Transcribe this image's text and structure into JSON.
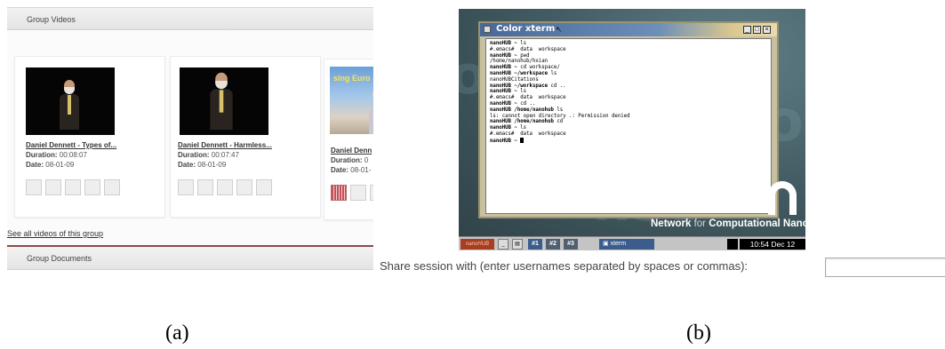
{
  "panel_a": {
    "header_videos": "Group Videos",
    "header_documents": "Group Documents",
    "duration_label": "Duration:",
    "date_label": "Date:",
    "videos": [
      {
        "title": "Daniel Dennett - Types of...",
        "duration": "00:08:07",
        "date": "08-01-09"
      },
      {
        "title": "Daniel Dennett - Harmless...",
        "duration": "00:07:47",
        "date": "08-01-09"
      },
      {
        "title": "Daniel Denn",
        "duration": "0",
        "date": "08-01-",
        "thumbnail_banner": "sing Euro"
      }
    ],
    "see_all_link": "See all videos of this group"
  },
  "panel_b": {
    "xterm_title": "Color xterm",
    "terminal_lines": [
      [
        {
          "t": "nanoHUB ~",
          "b": true
        },
        {
          "t": " ls"
        }
      ],
      [
        {
          "t": "#.emacs#  data  workspace"
        }
      ],
      [
        {
          "t": "nanoHUB ~",
          "b": true
        },
        {
          "t": " pwd"
        }
      ],
      [
        {
          "t": "/home/nanohub/hxian"
        }
      ],
      [
        {
          "t": "nanoHUB ~",
          "b": true
        },
        {
          "t": " cd workspace/"
        }
      ],
      [
        {
          "t": "nanoHUB ~/workspace",
          "b": true
        },
        {
          "t": " ls"
        }
      ],
      [
        {
          "t": "nanoHUBCitations"
        }
      ],
      [
        {
          "t": "nanoHUB ~/workspace",
          "b": true
        },
        {
          "t": " cd .."
        }
      ],
      [
        {
          "t": "nanoHUB ~",
          "b": true
        },
        {
          "t": " ls"
        }
      ],
      [
        {
          "t": "#.emacs#  data  workspace"
        }
      ],
      [
        {
          "t": "nanoHUB ~",
          "b": true
        },
        {
          "t": " cd .."
        }
      ],
      [
        {
          "t": "nanoHUB /home/nanohub",
          "b": true
        },
        {
          "t": " ls"
        }
      ],
      [
        {
          "t": "ls: cannot open directory .: Permission denied"
        }
      ],
      [
        {
          "t": "nanoHUB /home/nanohub",
          "b": true
        },
        {
          "t": " cd"
        }
      ],
      [
        {
          "t": "nanoHUB ~",
          "b": true
        },
        {
          "t": " ls"
        }
      ],
      [
        {
          "t": "#.emacs#  data  workspace"
        }
      ],
      [
        {
          "t": "nanoHUB ~",
          "b": true
        },
        {
          "t": " "
        }
      ]
    ],
    "brand_network": "Network",
    "brand_for": "for",
    "brand_rest": "Computational Nanc",
    "taskbar": {
      "logo": "nanoHUB",
      "ws1": "#1",
      "ws2": "#2",
      "ws3": "#3",
      "window_label": "xterm",
      "clock": "10:54 Dec 12"
    },
    "share_label": "Share session with (enter usernames separated by spaces or commas):",
    "share_value": ""
  },
  "captions": {
    "a": "(a)",
    "b": "(b)"
  },
  "colors": {
    "underline_separator": "#8e4b4b",
    "desktop_bg": "#40585f",
    "taskbar_logo": "#a83e20",
    "titlebar": "#47689a"
  }
}
